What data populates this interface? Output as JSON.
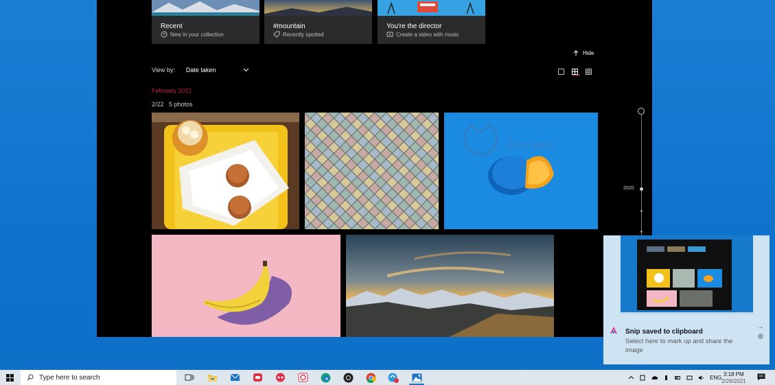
{
  "photos_app": {
    "cards": [
      {
        "title": "Recent",
        "subtitle": "New in your collection",
        "icon": "clock-icon"
      },
      {
        "title": "#mountain",
        "subtitle": "Recently spotted",
        "icon": "tag-icon"
      },
      {
        "title": "You're the director",
        "subtitle": "Create a video with music",
        "icon": "video-icon"
      }
    ],
    "hide_label": "Hide",
    "view_by_label": "View by:",
    "view_by_value": "Date taken",
    "month_heading": "February 2021",
    "day_heading": "2/22",
    "photo_count": "5 photos",
    "timeline_year": "2020",
    "photos": [
      {
        "subject": "muffins on plate with iced drink"
      },
      {
        "subject": "pastel diamond tiles"
      },
      {
        "subject": "blue egg with orange yolk"
      },
      {
        "subject": "banana on pink background"
      },
      {
        "subject": "mountain landscape at sunset"
      }
    ],
    "watermark_text": "Zom bera"
  },
  "toast": {
    "title": "Snip saved to clipboard",
    "body": "Select here to mark up and share the image",
    "arrow": "→"
  },
  "taskbar": {
    "search_placeholder": "Type here to search",
    "apps": [
      {
        "name": "task-view"
      },
      {
        "name": "file-explorer"
      },
      {
        "name": "mail"
      },
      {
        "name": "app-red"
      },
      {
        "name": "app-chat"
      },
      {
        "name": "app-sync"
      },
      {
        "name": "edge"
      },
      {
        "name": "app-dark"
      },
      {
        "name": "chrome"
      },
      {
        "name": "app-badge"
      },
      {
        "name": "photos"
      }
    ],
    "language": "ENG",
    "time": "3:18 PM",
    "date": "2/26/2021"
  },
  "colors": {
    "desktop": "#1279d0",
    "accent_pink": "#c3174f",
    "toast_bg": "#cfe4f3",
    "taskbar_bg": "#dfe6ee"
  }
}
